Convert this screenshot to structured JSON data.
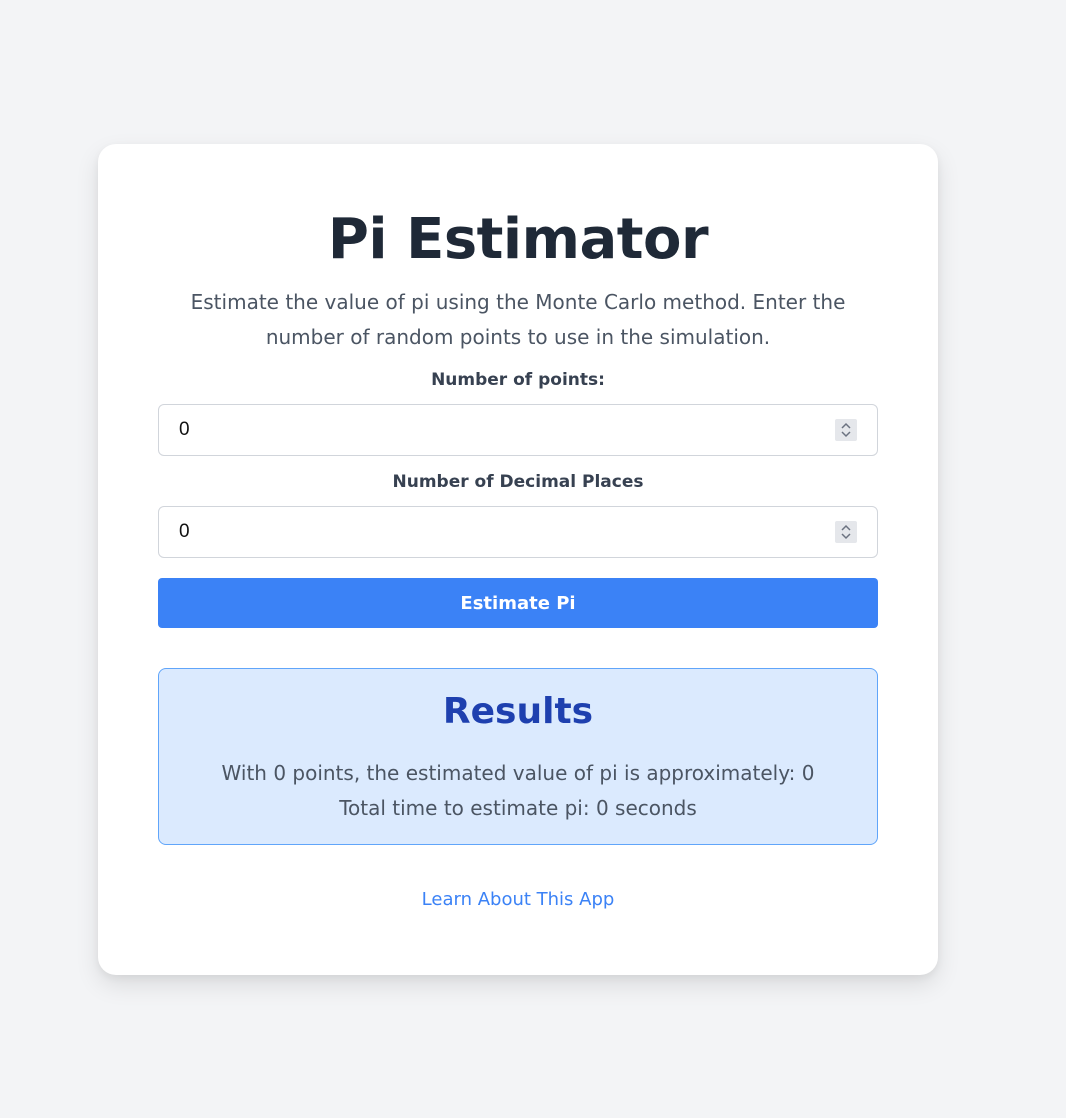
{
  "app": {
    "title": "Pi Estimator",
    "description": "Estimate the value of pi using the Monte Carlo method. Enter the number of random points to use in the simulation."
  },
  "form": {
    "points_label": "Number of points:",
    "points_value": "0",
    "decimals_label": "Number of Decimal Places",
    "decimals_value": "0",
    "submit_label": "Estimate Pi"
  },
  "results": {
    "title": "Results",
    "estimate_text": "With 0 points, the estimated value of pi is approximately: 0",
    "time_text": "Total time to estimate pi: 0 seconds"
  },
  "footer": {
    "link_label": "Learn About This App"
  },
  "icons": {
    "spinner": "number-spinner-icon"
  },
  "colors": {
    "background": "#f3f4f6",
    "card": "#ffffff",
    "accent": "#3b82f6",
    "results_bg": "#dbeafe",
    "results_border": "#60a5fa",
    "results_title": "#1e40af",
    "heading": "#1f2937",
    "body_text": "#4b5563"
  }
}
